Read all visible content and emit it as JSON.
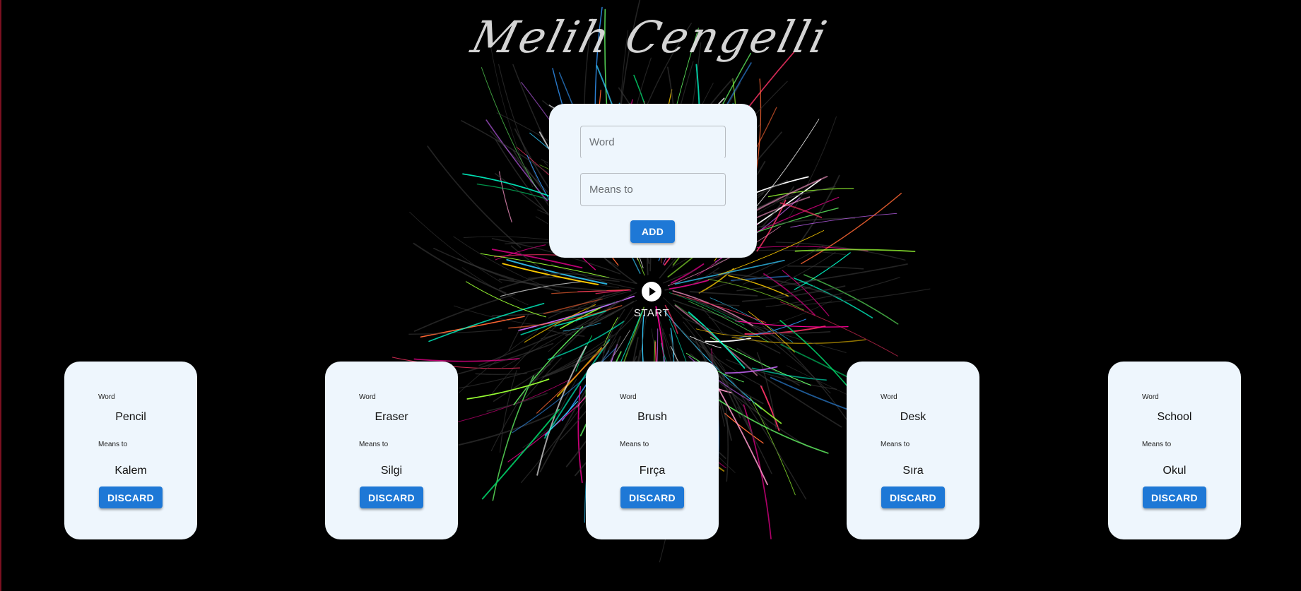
{
  "brand": {
    "title": "Melih Cengelli"
  },
  "add_form": {
    "word_placeholder": "Word",
    "means_placeholder": "Means to",
    "add_label": "ADD"
  },
  "start": {
    "label": "START",
    "icon": "play-circle-icon"
  },
  "cards": [
    {
      "word_label": "Word",
      "word": "Pencil",
      "means_label": "Means to",
      "means": "Kalem",
      "discard_label": "DISCARD"
    },
    {
      "word_label": "Word",
      "word": "Eraser",
      "means_label": "Means to",
      "means": "Silgi",
      "discard_label": "DISCARD"
    },
    {
      "word_label": "Word",
      "word": "Brush",
      "means_label": "Means to",
      "means": "Fırça",
      "discard_label": "DISCARD"
    },
    {
      "word_label": "Word",
      "word": "Desk",
      "means_label": "Means to",
      "means": "Sıra",
      "discard_label": "DISCARD"
    },
    {
      "word_label": "Word",
      "word": "School",
      "means_label": "Means to",
      "means": "Okul",
      "discard_label": "DISCARD"
    }
  ],
  "colors": {
    "background": "#000000",
    "card": "#eef6fd",
    "accent": "#1e78d6"
  }
}
